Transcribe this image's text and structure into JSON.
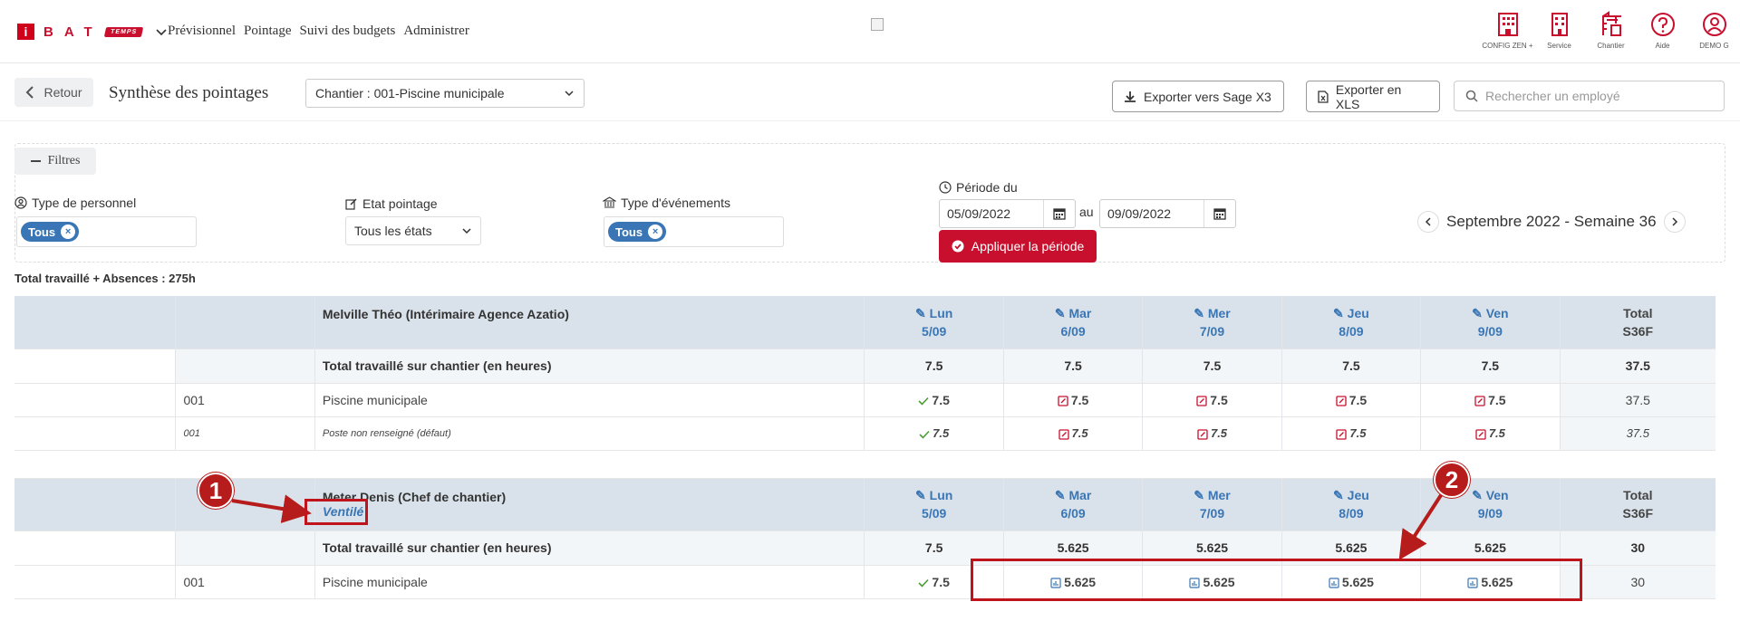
{
  "nav": {
    "logo_i": "i",
    "logo_letters": "BAT",
    "logo_temps": "TEMPS",
    "menu": [
      "Prévisionnel",
      "Pointage",
      "Suivi des budgets",
      "Administrer"
    ],
    "tools": [
      {
        "label": "CONFIG ZEN +",
        "icon": "building-config-icon"
      },
      {
        "label": "Service",
        "icon": "building-icon"
      },
      {
        "label": "Chantier",
        "icon": "crane-icon"
      },
      {
        "label": "Aide",
        "icon": "help-icon"
      },
      {
        "label": "DEMO G",
        "icon": "user-icon"
      }
    ],
    "accent": "#c8102e"
  },
  "titlebar": {
    "back_label": "Retour",
    "title": "Synthèse des pointages",
    "site_select": "Chantier : 001-Piscine municipale",
    "export_sage": "Exporter vers Sage X3",
    "export_xls": "Exporter en XLS",
    "search_placeholder": "Rechercher un employé"
  },
  "filters": {
    "toggle_label": "Filtres",
    "personnel_label": "Type de personnel",
    "personnel_tag": "Tous",
    "state_label": "Etat pointage",
    "state_value": "Tous les états",
    "event_label": "Type d'événements",
    "event_tag": "Tous",
    "period_label": "Période du",
    "date_from": "05/09/2022",
    "au": "au",
    "date_to": "09/09/2022",
    "apply_label": "Appliquer la période",
    "week_label": "Septembre 2022 - Semaine 36"
  },
  "total_line": "Total travaillé + Absences : 275h",
  "days": [
    {
      "name": "Lun",
      "date": "5/09"
    },
    {
      "name": "Mar",
      "date": "6/09"
    },
    {
      "name": "Mer",
      "date": "7/09"
    },
    {
      "name": "Jeu",
      "date": "8/09"
    },
    {
      "name": "Ven",
      "date": "9/09"
    }
  ],
  "total_head": {
    "l1": "Total",
    "l2": "S36F"
  },
  "employees": [
    {
      "name": "Melville Théo (Intérimaire Agence Azatio)",
      "sub": "",
      "sum_label": "Total travaillé sur chantier (en heures)",
      "sum_values": [
        "7.5",
        "7.5",
        "7.5",
        "7.5",
        "7.5"
      ],
      "sum_total": "37.5",
      "lines": [
        {
          "code": "001",
          "label": "Piscine municipale",
          "values": [
            "7.5",
            "7.5",
            "7.5",
            "7.5",
            "7.5"
          ],
          "types": [
            "ok",
            "ed",
            "ed",
            "ed",
            "ed"
          ],
          "total": "37.5",
          "small": false
        },
        {
          "code": "001",
          "label": "Poste non renseigné (défaut)",
          "values": [
            "7.5",
            "7.5",
            "7.5",
            "7.5",
            "7.5"
          ],
          "types": [
            "ok",
            "ed",
            "ed",
            "ed",
            "ed"
          ],
          "total": "37.5",
          "small": true
        }
      ]
    },
    {
      "name": "Meter Denis (Chef de chantier)",
      "sub": "Ventilé",
      "sum_label": "Total travaillé sur chantier (en heures)",
      "sum_values": [
        "7.5",
        "5.625",
        "5.625",
        "5.625",
        "5.625"
      ],
      "sum_total": "30",
      "lines": [
        {
          "code": "001",
          "label": "Piscine municipale",
          "values": [
            "7.5",
            "5.625",
            "5.625",
            "5.625",
            "5.625"
          ],
          "types": [
            "ok",
            "ch",
            "ch",
            "ch",
            "ch"
          ],
          "total": "30",
          "small": false
        }
      ]
    }
  ],
  "annotations": {
    "badge1": "1",
    "badge2": "2",
    "color": "#b71c1c"
  }
}
